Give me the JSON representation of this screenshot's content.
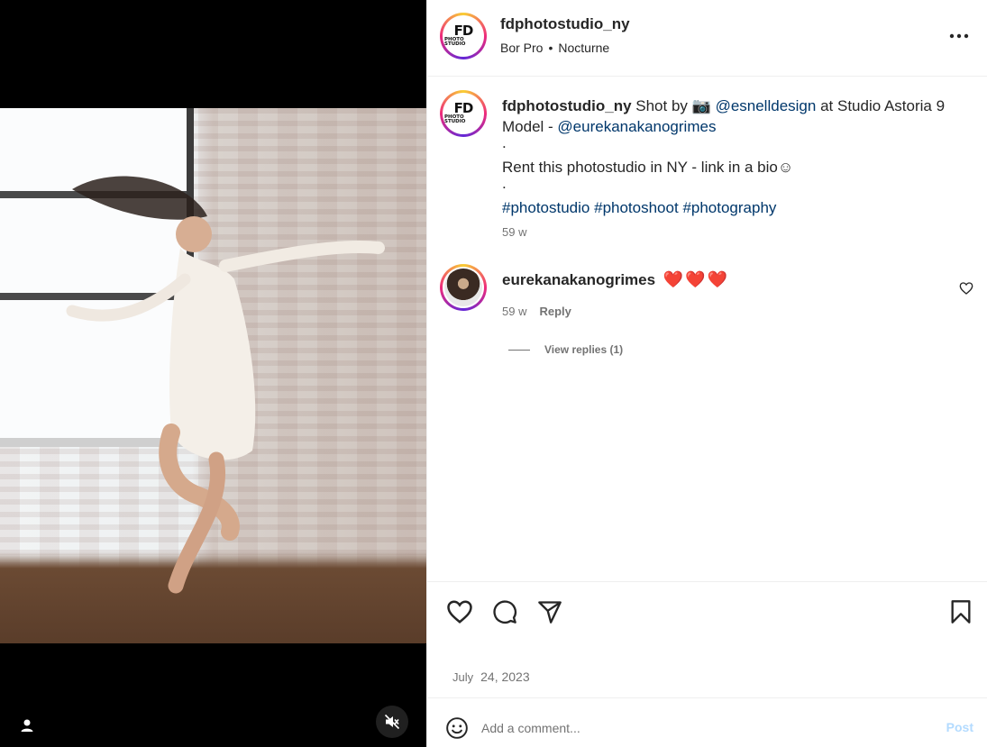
{
  "post_author": {
    "username": "fdphotostudio_ny",
    "audio_artist": "Bor Pro",
    "separator": "•",
    "audio_track": "Nocturne",
    "logo_text_main": "FD",
    "logo_text_sub": "PHOTO STUDIO"
  },
  "caption": {
    "username": "fdphotostudio_ny",
    "text_shot_by": "Shot by",
    "camera_emoji": "📷",
    "mention_photographer": "@esnelldesign",
    "text_location": "at Studio Astoria 9",
    "text_model": "Model -",
    "mention_model": "@eurekanakanogrimes",
    "dot1": ".",
    "line_rent": "Rent this photostudio in NY - link in a bio☺",
    "dot2": ".",
    "hashtags": [
      "#photostudio",
      "#photoshoot",
      "#photography"
    ],
    "time_value": "59",
    "time_unit": "w"
  },
  "comments": [
    {
      "username": "eurekanakanogrimes",
      "text": "❤️❤️❤️",
      "time_value": "59",
      "time_unit": "w",
      "reply_label": "Reply",
      "view_replies_label": "View replies (1)"
    }
  ],
  "post_date": {
    "month": "July",
    "day_year": "24, 2023"
  },
  "add_comment": {
    "placeholder": "Add a comment...",
    "post_label": "Post"
  },
  "colors": {
    "link": "#00376b",
    "muted": "#737373",
    "heart": "#e3262f",
    "post_disabled": "#b3dbff"
  },
  "icons": [
    "more-options-icon",
    "like-icon",
    "comment-icon",
    "share-icon",
    "save-icon",
    "emoji-icon",
    "user-tag-icon",
    "mute-icon",
    "comment-like-icon",
    "camera-icon"
  ]
}
